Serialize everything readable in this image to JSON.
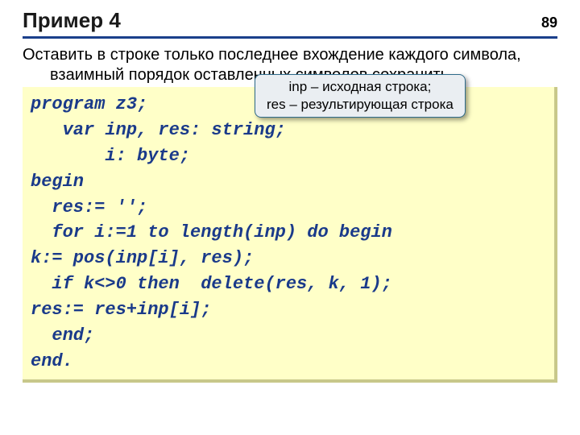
{
  "header": {
    "title": "Пример 4",
    "pagenum": "89"
  },
  "description": "Оставить в строке только последнее вхождение каждого символа, взаимный порядок оставленных символов сохранить.",
  "callout": {
    "line1": "inp – исходная строка;",
    "line2": "res – результирующая строка"
  },
  "code": "program z3;\n   var inp, res: string;\n       i: byte;\nbegin\n  res:= '';\n  for i:=1 to length(inp) do begin\nk:= pos(inp[i], res);\n  if k<>0 then  delete(res, k, 1);\nres:= res+inp[i];\n  end;\nend."
}
